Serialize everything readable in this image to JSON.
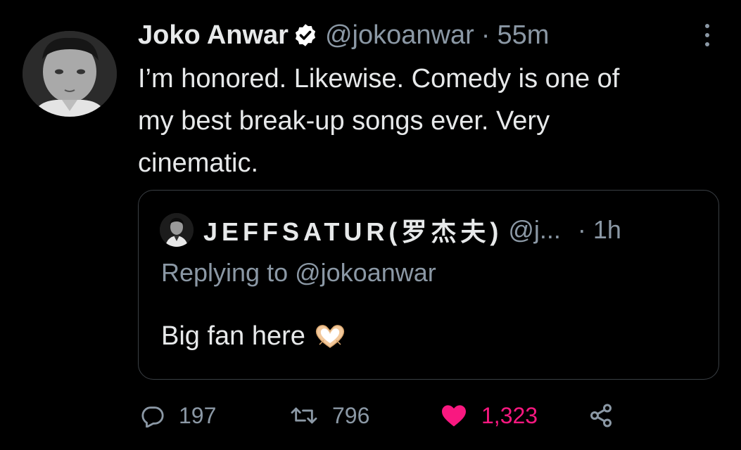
{
  "tweet": {
    "author": {
      "name": "Joko Anwar",
      "handle": "@jokoanwar",
      "verified": true
    },
    "separator": "·",
    "time": "55m",
    "text": "I’m honored. Likewise. Comedy is one of\nmy best break-up songs ever. Very\ncinematic.",
    "more_icon": "more-vertical-icon"
  },
  "quoted_tweet": {
    "author": {
      "name": "JEFFSATUR(罗杰夫)",
      "handle": "@j..."
    },
    "separator": "·",
    "time": "1h",
    "replying_to": "Replying to @jokoanwar",
    "text": "Big fan here",
    "emoji": "heart-hands-emoji"
  },
  "actions": {
    "reply": {
      "icon": "reply-icon",
      "count": "197"
    },
    "retweet": {
      "icon": "retweet-icon",
      "count": "796"
    },
    "like": {
      "icon": "heart-icon",
      "count": "1,323",
      "active": true,
      "color": "#f91880"
    },
    "share": {
      "icon": "share-icon"
    }
  },
  "colors": {
    "background": "#000000",
    "text": "#e7e9ea",
    "secondary": "#8b98a5",
    "verified_badge": "#ffffff",
    "like_active": "#f91880"
  }
}
